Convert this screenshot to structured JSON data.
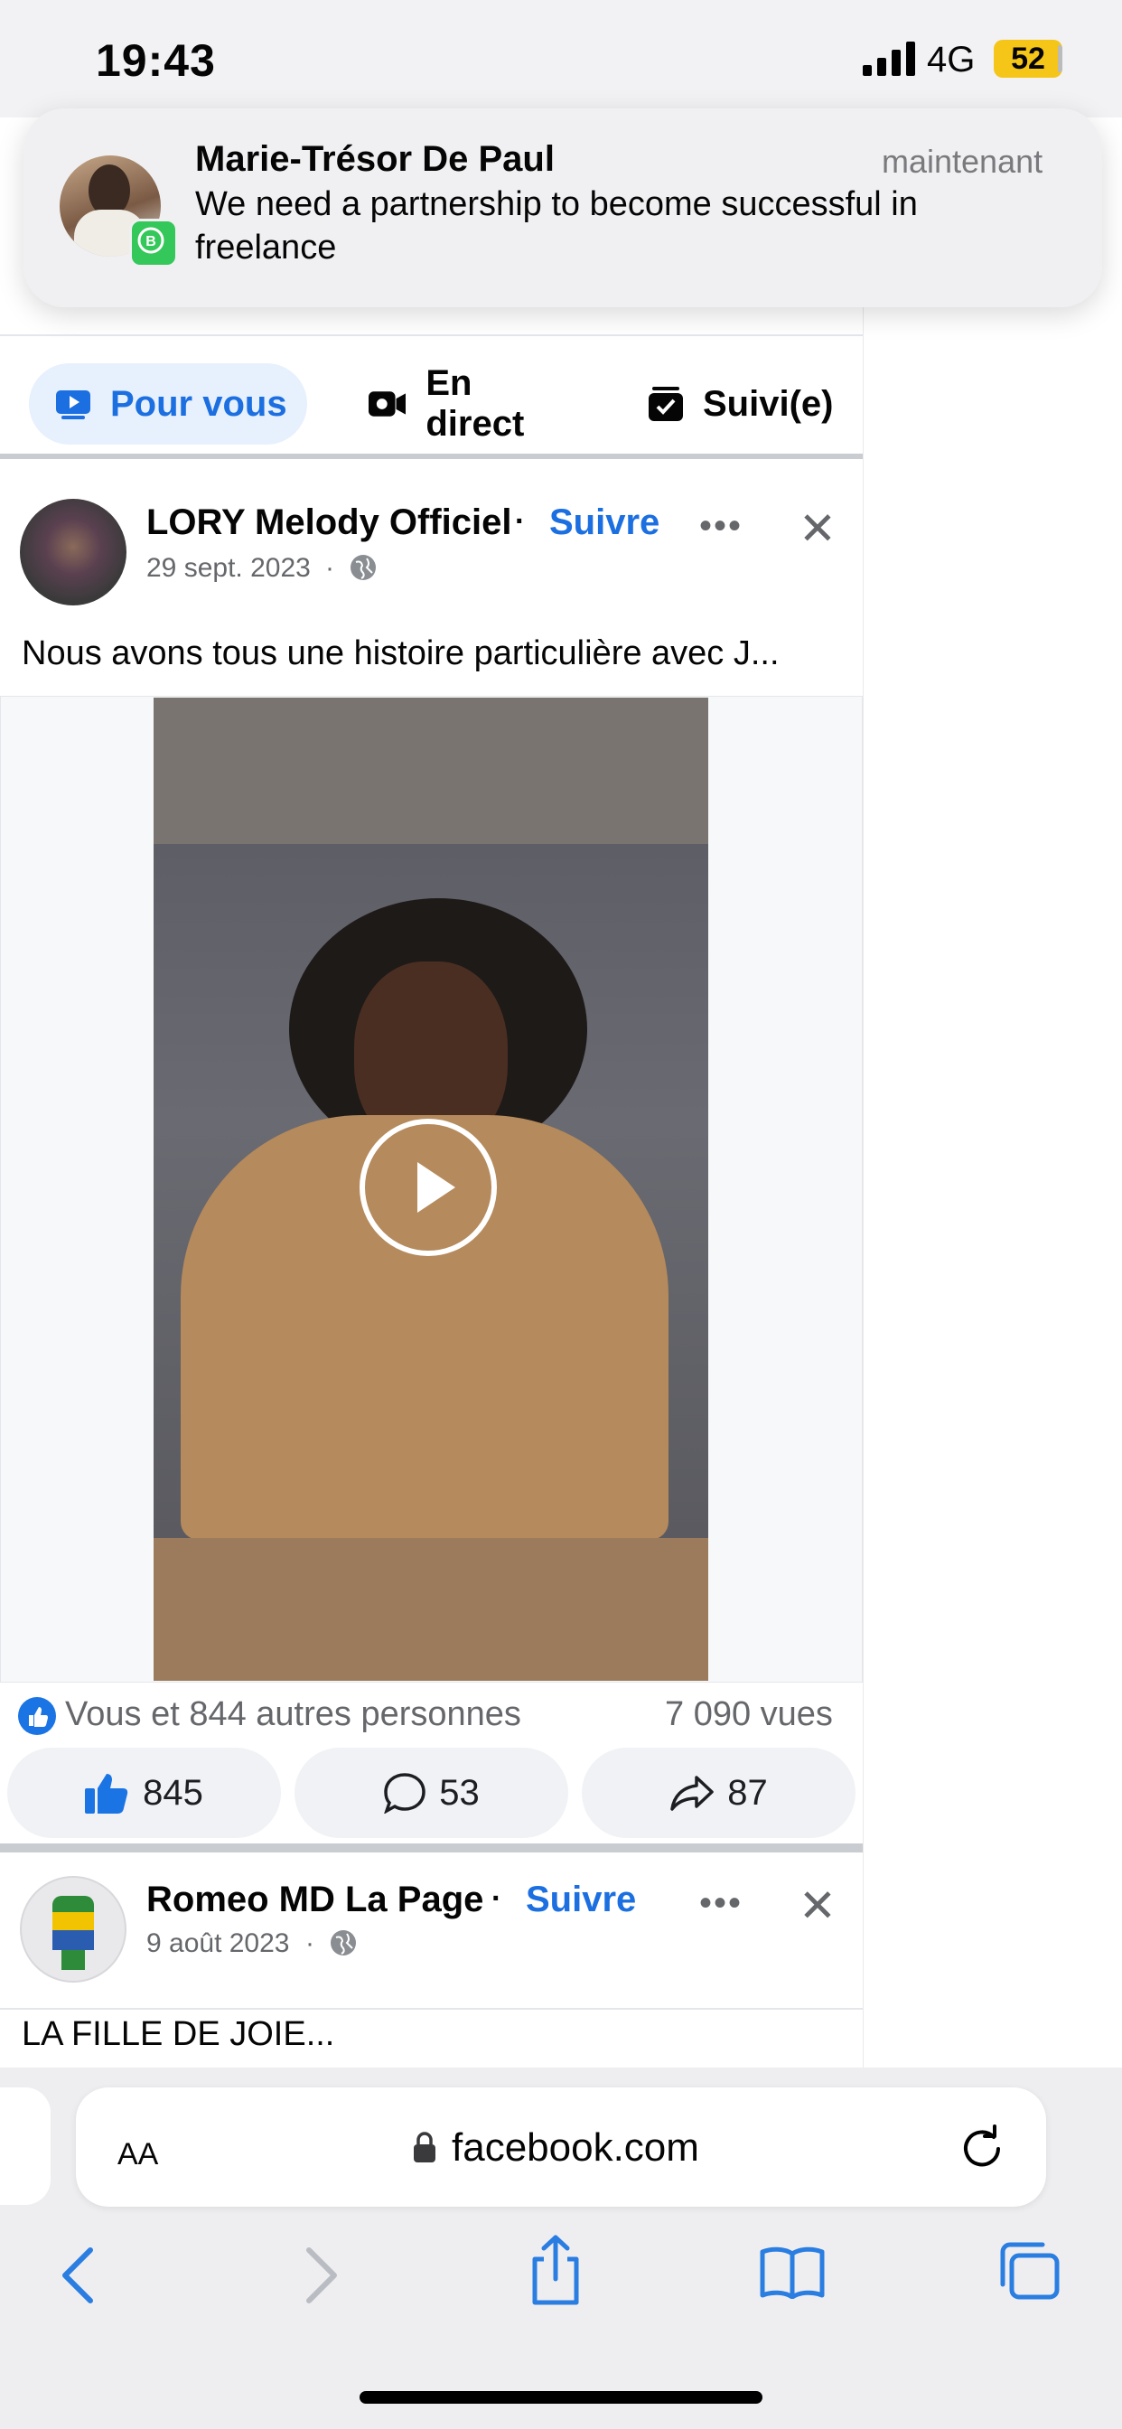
{
  "status_bar": {
    "time": "19:43",
    "network": "4G",
    "battery": "52"
  },
  "notification": {
    "sender": "Marie-Trésor De Paul",
    "time": "maintenant",
    "message": "We need a partnership to become successful in freelance",
    "app_icon": "whatsapp-business-icon"
  },
  "tabs": [
    {
      "label": "Pour vous",
      "icon": "video-play-icon",
      "selected": true
    },
    {
      "label": "En direct",
      "icon": "live-camera-icon",
      "selected": false
    },
    {
      "label": "Suivi(e)",
      "icon": "following-box-icon",
      "selected": false
    }
  ],
  "posts": [
    {
      "author": "LORY Melody Officiel",
      "follow_label": "Suivre",
      "date": "29 sept. 2023",
      "text": "Nous avons tous une histoire particulière avec J...",
      "reactions_summary": "Vous et 844 autres personnes",
      "views": "7 090 vues",
      "likes": "845",
      "comments": "53",
      "shares": "87"
    },
    {
      "author": "Romeo MD La Page",
      "follow_label": "Suivre",
      "date": "9 août 2023",
      "text": "LA FILLE DE JOIE..."
    }
  ],
  "browser": {
    "text_size_label": "AA",
    "url": "facebook.com"
  },
  "colors": {
    "accent": "#1b6fe0",
    "tab_active_bg": "#e7f0fd"
  }
}
